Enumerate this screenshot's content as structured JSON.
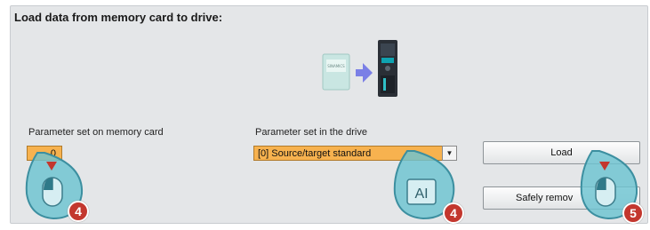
{
  "dialog": {
    "title": "Load data from memory card to drive:"
  },
  "graphic": {
    "icon": "memory-card-to-drive-graphic",
    "card_text": "SINAMICS"
  },
  "memory_card": {
    "label": "Parameter set on memory card",
    "value": "0"
  },
  "drive": {
    "label": "Parameter set in the drive",
    "selected": "[0] Source/target standard"
  },
  "buttons": {
    "load": "Load",
    "safely_remove": "Safely remov"
  },
  "callouts": {
    "mouse_1": "4",
    "keyboard_1_icon_text": "AI",
    "keyboard_1": "4",
    "mouse_2": "5"
  },
  "colors": {
    "field_highlight": "#f7b24f",
    "callout_blue": "#5fb8c9",
    "badge_red": "#c3372e",
    "arrow": "#7a7fe6"
  }
}
